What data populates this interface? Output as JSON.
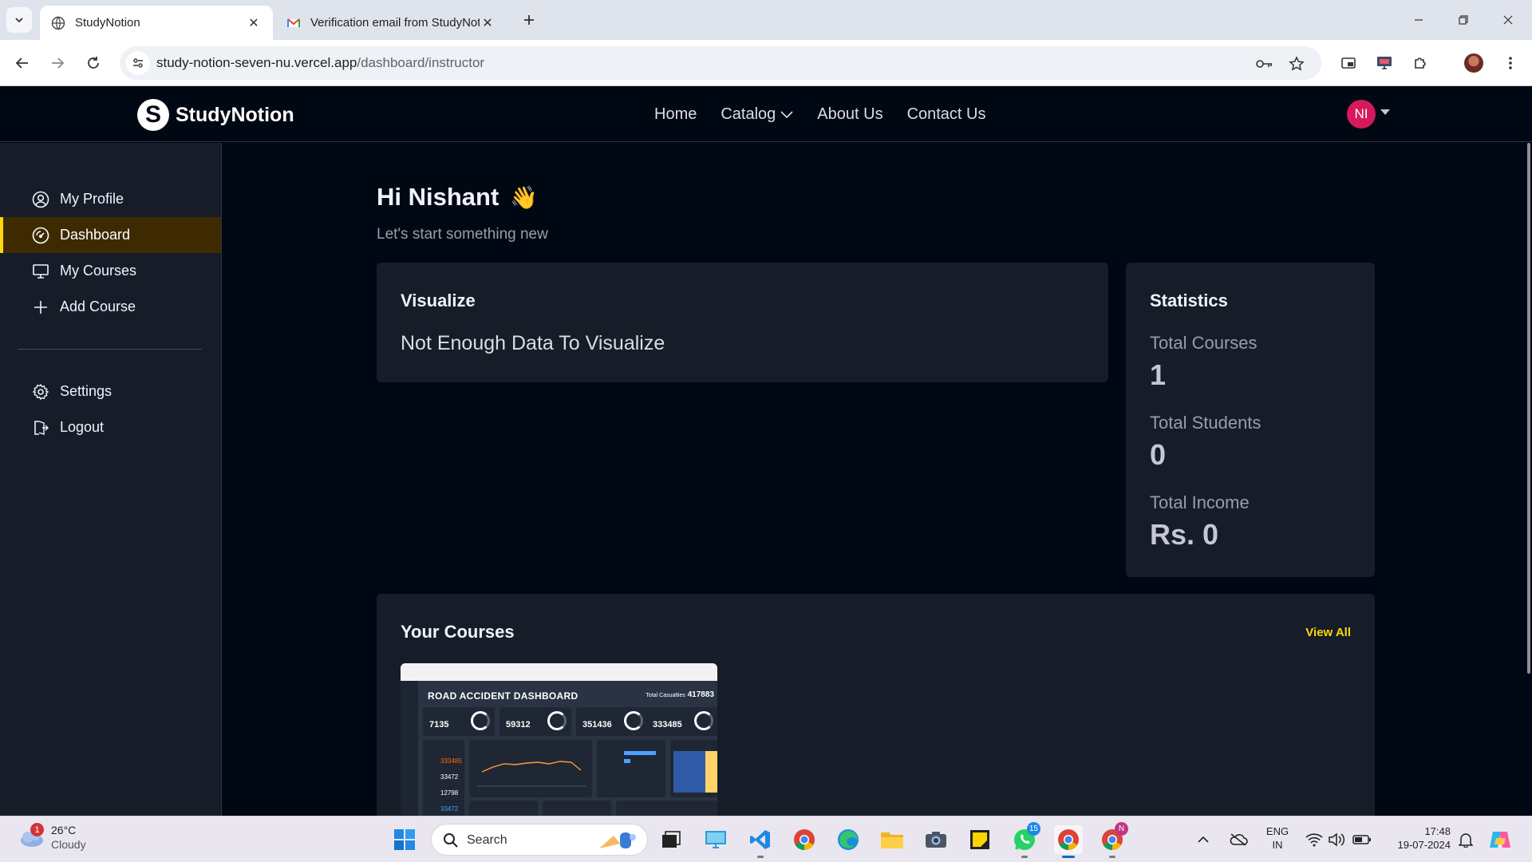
{
  "browser": {
    "tabs": [
      {
        "title": "StudyNotion",
        "active": true
      },
      {
        "title": "Verification email from StudyNotion",
        "active": false
      }
    ],
    "url_host": "study-notion-seven-nu.vercel.app",
    "url_path": "/dashboard/instructor"
  },
  "navbar": {
    "brand_letter": "S",
    "brand": "StudyNotion",
    "links": [
      "Home",
      "Catalog",
      "About Us",
      "Contact Us"
    ],
    "user_initials": "NI"
  },
  "sidebar": {
    "items": [
      {
        "label": "My Profile",
        "icon": "profile-icon",
        "active": false
      },
      {
        "label": "Dashboard",
        "icon": "dashboard-icon",
        "active": true
      },
      {
        "label": "My Courses",
        "icon": "monitor-icon",
        "active": false
      },
      {
        "label": "Add Course",
        "icon": "plus-icon",
        "active": false
      }
    ],
    "bottom_items": [
      {
        "label": "Settings",
        "icon": "gear-icon"
      },
      {
        "label": "Logout",
        "icon": "logout-icon"
      }
    ]
  },
  "main": {
    "greeting": "Hi Nishant",
    "wave": "👋",
    "subgreeting": "Let's start something new",
    "visualize": {
      "title": "Visualize",
      "message": "Not Enough Data To Visualize"
    },
    "statistics": {
      "title": "Statistics",
      "items": [
        {
          "label": "Total Courses",
          "value": "1"
        },
        {
          "label": "Total Students",
          "value": "0"
        },
        {
          "label": "Total Income",
          "value": "Rs. 0"
        }
      ]
    },
    "courses": {
      "title": "Your Courses",
      "view_all": "View All",
      "thumbnail": {
        "title": "ROAD ACCIDENT DASHBOARD",
        "total_label": "Total Casualties",
        "total_value": "417883",
        "kpis": [
          "7135",
          "59312",
          "351436",
          "333485"
        ],
        "side_values": [
          "333485",
          "33472",
          "12798",
          "33472"
        ]
      }
    }
  },
  "taskbar": {
    "weather_temp": "26°C",
    "weather_cond": "Cloudy",
    "weather_alerts": "1",
    "search_label": "Search",
    "whatsapp_badge": "15",
    "chrome_profile_badge": "N",
    "lang_line1": "ENG",
    "lang_line2": "IN",
    "time": "17:48",
    "date": "19-07-2024"
  },
  "colors": {
    "accent_yellow": "#FFD60A",
    "bg": "#000814",
    "card": "#161D29",
    "avatar": "#D6195C"
  }
}
